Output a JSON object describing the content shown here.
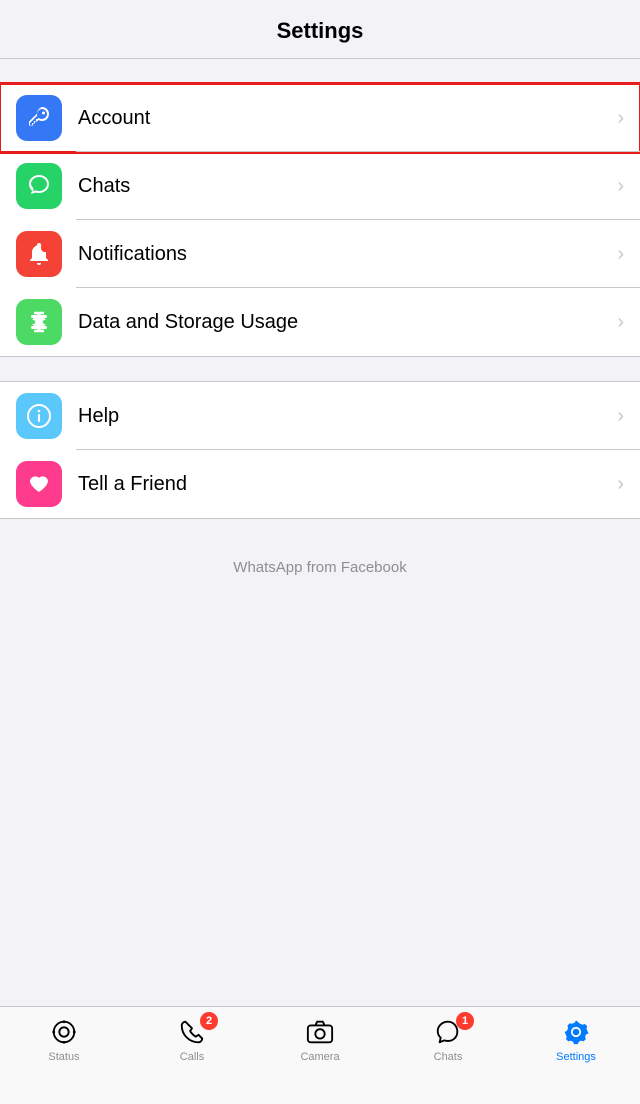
{
  "header": {
    "title": "Settings"
  },
  "groups": [
    {
      "id": "group1",
      "items": [
        {
          "id": "account",
          "label": "Account",
          "icon": "key",
          "iconColor": "icon-blue",
          "highlighted": true
        },
        {
          "id": "chats",
          "label": "Chats",
          "icon": "chat",
          "iconColor": "icon-green",
          "highlighted": false
        },
        {
          "id": "notifications",
          "label": "Notifications",
          "icon": "bell",
          "iconColor": "icon-red",
          "highlighted": false
        },
        {
          "id": "data",
          "label": "Data and Storage Usage",
          "icon": "data",
          "iconColor": "icon-green2",
          "highlighted": false
        }
      ]
    },
    {
      "id": "group2",
      "items": [
        {
          "id": "help",
          "label": "Help",
          "icon": "info",
          "iconColor": "icon-blue2",
          "highlighted": false
        },
        {
          "id": "tell-friend",
          "label": "Tell a Friend",
          "icon": "heart",
          "iconColor": "icon-pink",
          "highlighted": false
        }
      ]
    }
  ],
  "footer": {
    "text": "WhatsApp from Facebook"
  },
  "tabBar": {
    "items": [
      {
        "id": "status",
        "label": "Status",
        "icon": "status",
        "badge": null,
        "active": false
      },
      {
        "id": "calls",
        "label": "Calls",
        "icon": "calls",
        "badge": "2",
        "active": false
      },
      {
        "id": "camera",
        "label": "Camera",
        "icon": "camera",
        "badge": null,
        "active": false
      },
      {
        "id": "chats",
        "label": "Chats",
        "icon": "chats",
        "badge": "1",
        "active": false
      },
      {
        "id": "settings",
        "label": "Settings",
        "icon": "settings",
        "badge": null,
        "active": true
      }
    ]
  }
}
